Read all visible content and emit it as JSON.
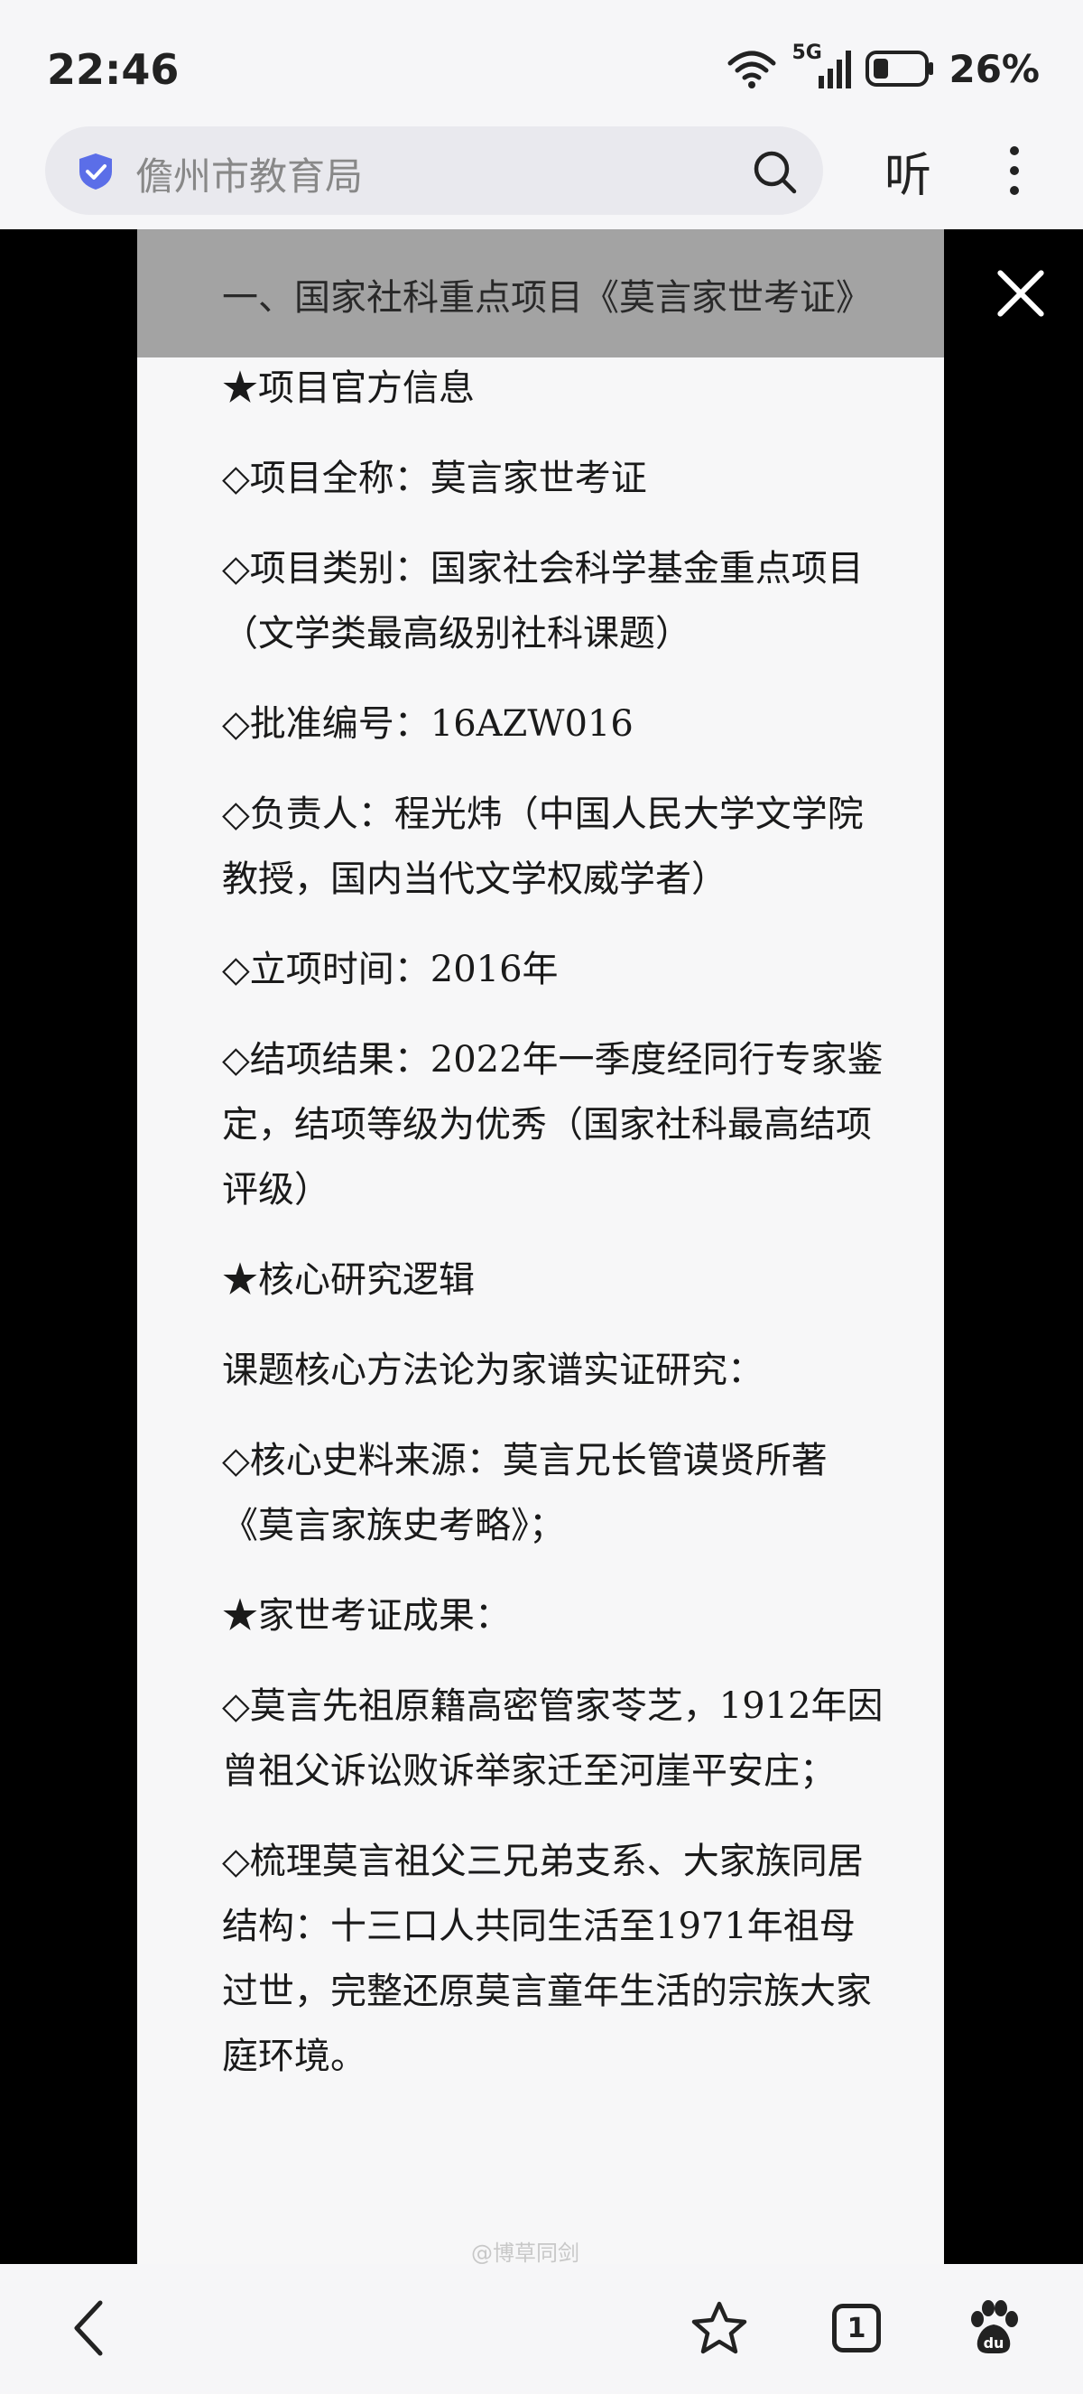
{
  "status": {
    "time": "22:46",
    "network": "5G",
    "battery": "26%"
  },
  "browser": {
    "url_title": "儋州市教育局",
    "listen_label": "听",
    "tab_count": "1"
  },
  "article": {
    "paragraphs": [
      "一、国家社科重点项目《莫言家世考证》",
      "★项目官方信息",
      "◇项目全称：莫言家世考证",
      "◇项目类别：国家社会科学基金重点项目（文学类最高级别社科课题）",
      "◇批准编号：16AZW016",
      "◇负责人：程光炜（中国人民大学文学院教授，国内当代文学权威学者）",
      "◇立项时间：2016年",
      "◇结项结果：2022年一季度经同行专家鉴定，结项等级为优秀（国家社科最高结项评级）",
      "★核心研究逻辑",
      "课题核心方法论为家谱实证研究：",
      "◇核心史料来源：莫言兄长管谟贤所著《莫言家族史考略》；",
      "★家世考证成果：",
      "◇莫言先祖原籍高密管家苓芝，1912年因曾祖父诉讼败诉举家迁至河崖平安庄；",
      "◇梳理莫言祖父三兄弟支系、大家族同居结构：十三口人共同生活至1971年祖母过世，完整还原莫言童年生活的宗族大家庭环境。"
    ],
    "watermark": "@博草同剑"
  },
  "colors": {
    "accent_shield": "#5b6ee8",
    "page_bg": "#f7f7f8",
    "chrome_bg": "#f6f6f8"
  }
}
